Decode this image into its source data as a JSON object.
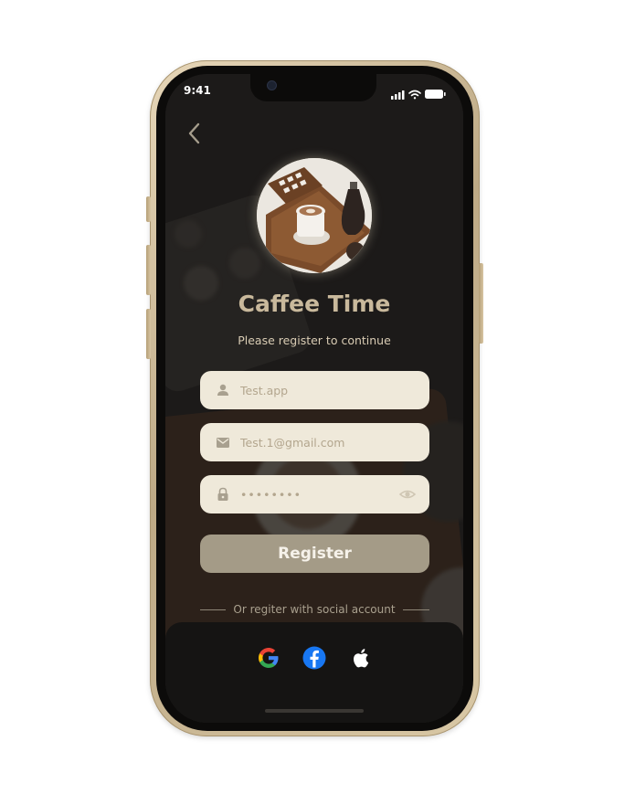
{
  "status_bar": {
    "time": "9:41"
  },
  "app": {
    "title": "Caffee Time",
    "subtitle": "Please register to continue"
  },
  "form": {
    "username": {
      "placeholder": "Test.app",
      "icon": "person-icon"
    },
    "email": {
      "placeholder": "Test.1@gmail.com",
      "icon": "mail-icon"
    },
    "password": {
      "value": "••••••••",
      "icon": "lock-icon",
      "toggle_icon": "eye-icon"
    }
  },
  "register_label": "Register",
  "social": {
    "divider_text": "Or regiter with social account",
    "providers": [
      "google",
      "facebook",
      "apple"
    ]
  },
  "colors": {
    "accent": "#a49b87",
    "title": "#c9b99c",
    "field_bg": "#efe9da",
    "frame": "#cdb993"
  }
}
